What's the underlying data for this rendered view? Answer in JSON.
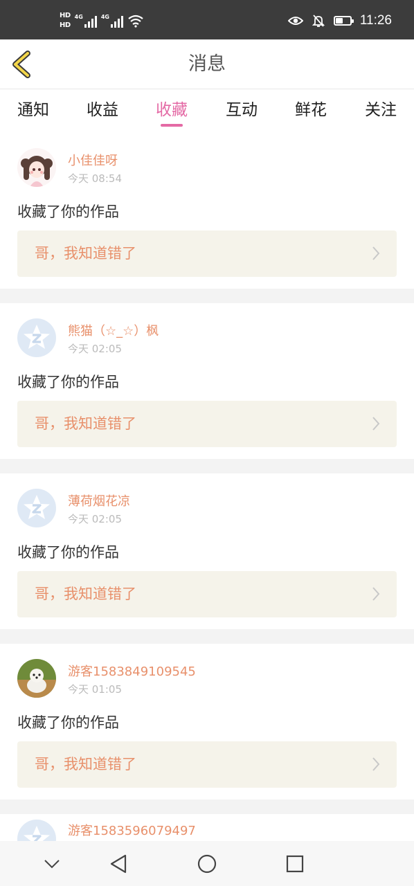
{
  "status_bar": {
    "hd1": "HD",
    "hd2": "HD",
    "signal1_label": "4G",
    "signal2_label": "4G",
    "time": "11:26",
    "battery_level": 0.5
  },
  "header": {
    "title": "消息"
  },
  "tabs": [
    {
      "label": "通知",
      "active": false
    },
    {
      "label": "收益",
      "active": false
    },
    {
      "label": "收藏",
      "active": true
    },
    {
      "label": "互动",
      "active": false
    },
    {
      "label": "鲜花",
      "active": false
    },
    {
      "label": "关注",
      "active": false
    }
  ],
  "messages": [
    {
      "user": "小佳佳呀",
      "time": "今天 08:54",
      "action": "收藏了你的作品",
      "work_title": "哥，我知道错了",
      "avatar": "girl-avatar"
    },
    {
      "user": "熊猫（☆_☆）枫",
      "time": "今天 02:05",
      "action": "收藏了你的作品",
      "work_title": "哥，我知道错了",
      "avatar": "default-avatar"
    },
    {
      "user": "薄荷烟花凉",
      "time": "今天 02:05",
      "action": "收藏了你的作品",
      "work_title": "哥，我知道错了",
      "avatar": "default-avatar"
    },
    {
      "user": "游客1583849109545",
      "time": "今天 01:05",
      "action": "收藏了你的作品",
      "work_title": "哥，我知道错了",
      "avatar": "dog-avatar"
    },
    {
      "user": "游客1583596079497",
      "avatar": "default-avatar"
    }
  ],
  "colors": {
    "accent_pink": "#e46aa5",
    "username_orange": "#e8906b",
    "quote_background": "#f5f3ea",
    "back_arrow": "#f3d64a"
  }
}
